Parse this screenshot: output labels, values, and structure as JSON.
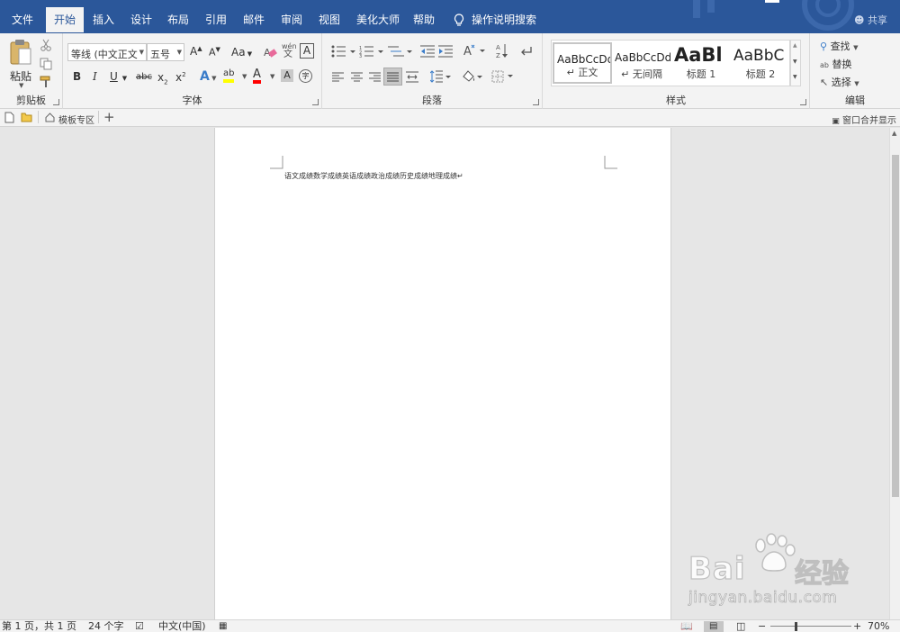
{
  "menu": {
    "items": [
      "文件",
      "开始",
      "插入",
      "设计",
      "布局",
      "引用",
      "邮件",
      "审阅",
      "视图",
      "美化大师",
      "帮助"
    ],
    "active_index": 1,
    "tell_me": "操作说明搜索",
    "share": "共享"
  },
  "ribbon": {
    "clipboard": {
      "label": "剪贴板",
      "paste": "粘贴"
    },
    "font": {
      "label": "字体",
      "font_name": "等线 (中文正文",
      "font_size": "五号",
      "grow": "A",
      "shrink": "A",
      "change_case": "Aa",
      "pinyin": "wén",
      "char_border": "A",
      "bold": "B",
      "italic": "I",
      "underline": "U",
      "strike": "abc",
      "subscript": "x",
      "superscript": "x",
      "sub_mark": "2",
      "sup_mark": "2",
      "effects": "A",
      "highlight": "ab",
      "font_color": "A",
      "shading": "A",
      "enclose": "字"
    },
    "paragraph": {
      "label": "段落"
    },
    "styles": {
      "label": "样式",
      "cards": [
        {
          "sample": "AaBbCcDd",
          "name": "↵ 正文"
        },
        {
          "sample": "AaBbCcDd",
          "name": "↵ 无间隔"
        },
        {
          "sample": "AaBl",
          "name": "标题 1"
        },
        {
          "sample": "AaBbC",
          "name": "标题 2"
        }
      ]
    },
    "editing": {
      "label": "编辑",
      "find": "查找",
      "replace": "替换",
      "select": "选择"
    }
  },
  "tabstrip": {
    "tab_label": "模板专区",
    "merge": "窗口合并显示"
  },
  "document": {
    "text": "语文成绩数学成绩英语成绩政治成绩历史成绩地理成绩↵"
  },
  "status": {
    "page": "第 1 页，共 1 页",
    "words": "24 个字",
    "language": "中文(中国)",
    "zoom": "70%"
  },
  "watermark": {
    "main": "Bai",
    "cn": "经验",
    "sub": "jingyan.baidu.com"
  },
  "colors": {
    "accent": "#2b579a",
    "ribbon": "#f3f3f3",
    "workspace": "#e6e6e6",
    "highlight": "#ffff00",
    "font_color": "#ff0000"
  }
}
